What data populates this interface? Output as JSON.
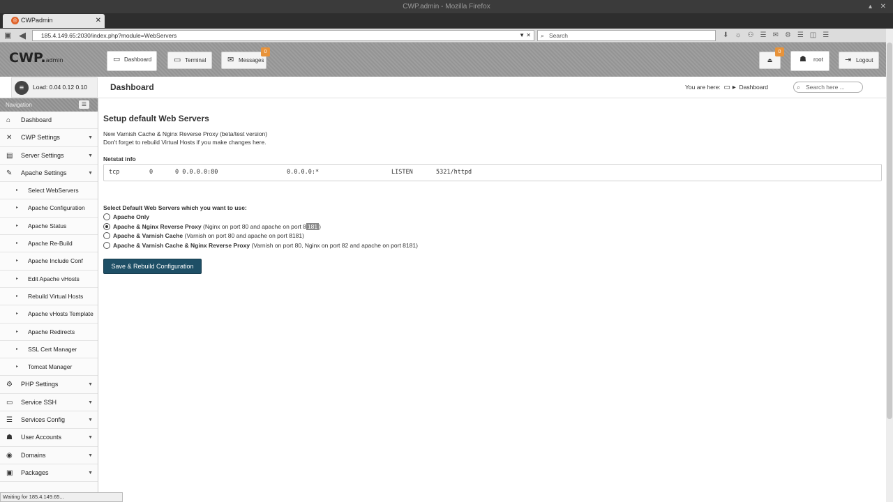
{
  "window": {
    "title": "CWP.admin - Mozilla Firefox",
    "controls": [
      "▴",
      "✕"
    ]
  },
  "browser": {
    "tab_title": "CWPadmin",
    "tab_favicon": "circle-icon",
    "new_tab": "+",
    "url": "185.4.149.65:2030/index.php?module=WebServers",
    "search_placeholder": "Search",
    "status_text": "Waiting for 185.4.149.65..."
  },
  "header": {
    "logo": "CWP.",
    "logo_suffix": "admin",
    "tabs": [
      {
        "label": "Dashboard",
        "icon": "monitor-icon"
      },
      {
        "label": "Terminal",
        "icon": "terminal-icon"
      },
      {
        "label": "Messages",
        "icon": "envelope-icon"
      }
    ],
    "messages_count": "0",
    "notifications_count": "0",
    "user": "root",
    "logout": "Logout"
  },
  "load": {
    "text": "Load: 0.04  0.12  0.10"
  },
  "page": {
    "title": "Dashboard"
  },
  "breadcrumb": {
    "prefix": "You are here:",
    "current": "Dashboard"
  },
  "search": {
    "placeholder": "Search here ..."
  },
  "sidebar": {
    "header": "Navigation",
    "items": [
      {
        "label": "Dashboard",
        "icon": "home-icon"
      },
      {
        "label": "CWP Settings",
        "icon": "wrench-icon"
      },
      {
        "label": "Server Settings",
        "icon": "server-icon"
      },
      {
        "label": "Apache Settings",
        "icon": "feather-icon"
      },
      {
        "label": "Select WebServers",
        "sub": true
      },
      {
        "label": "Apache Configuration",
        "sub": true
      },
      {
        "label": "Apache Status",
        "sub": true
      },
      {
        "label": "Apache Re-Build",
        "sub": true
      },
      {
        "label": "Apache Include Conf",
        "sub": true
      },
      {
        "label": "Edit Apache vHosts",
        "sub": true
      },
      {
        "label": "Rebuild Virtual Hosts",
        "sub": true
      },
      {
        "label": "Apache vHosts Template",
        "sub": true
      },
      {
        "label": "Apache Redirects",
        "sub": true
      },
      {
        "label": "SSL Cert Manager",
        "sub": true
      },
      {
        "label": "Tomcat Manager",
        "sub": true
      },
      {
        "label": "PHP Settings",
        "icon": "gear-icon"
      },
      {
        "label": "Service SSH",
        "icon": "monitor-icon"
      },
      {
        "label": "Services Config",
        "icon": "list-icon"
      },
      {
        "label": "User Accounts",
        "icon": "users-icon"
      },
      {
        "label": "Domains",
        "icon": "globe-icon"
      },
      {
        "label": "Packages",
        "icon": "package-icon"
      }
    ]
  },
  "content": {
    "heading": "Setup default Web Servers",
    "desc_line1": "New Varnish Cache & Nginx Reverse Proxy (beta/test version)",
    "desc_line2": "Don't forget to rebuild Virtual Hosts if you make changes here.",
    "netstat_label": "Netstat info",
    "netstat": [
      "tcp",
      "0",
      "0 0.0.0.0:80",
      "0.0.0.0:*",
      "LISTEN",
      "5321/httpd"
    ],
    "select_label": "Select Default Web Servers which you want to use:",
    "options": [
      {
        "name": "Apache Only",
        "detail": "",
        "checked": false
      },
      {
        "name": "Apache & Nginx Reverse Proxy",
        "detail": "(Nginx on port 80 and apache on port 8",
        "sel": "181",
        "tail": ")",
        "checked": true
      },
      {
        "name": "Apache & Varnish Cache",
        "detail": "(Varnish on port 80 and apache on port 8181)",
        "checked": false
      },
      {
        "name": "Apache & Varnish Cache & Nginx Reverse Proxy",
        "detail": "(Varnish on port 80, Nginx on port 82 and apache on port 8181)",
        "checked": false
      }
    ],
    "button": "Save & Rebuild Configuration"
  }
}
